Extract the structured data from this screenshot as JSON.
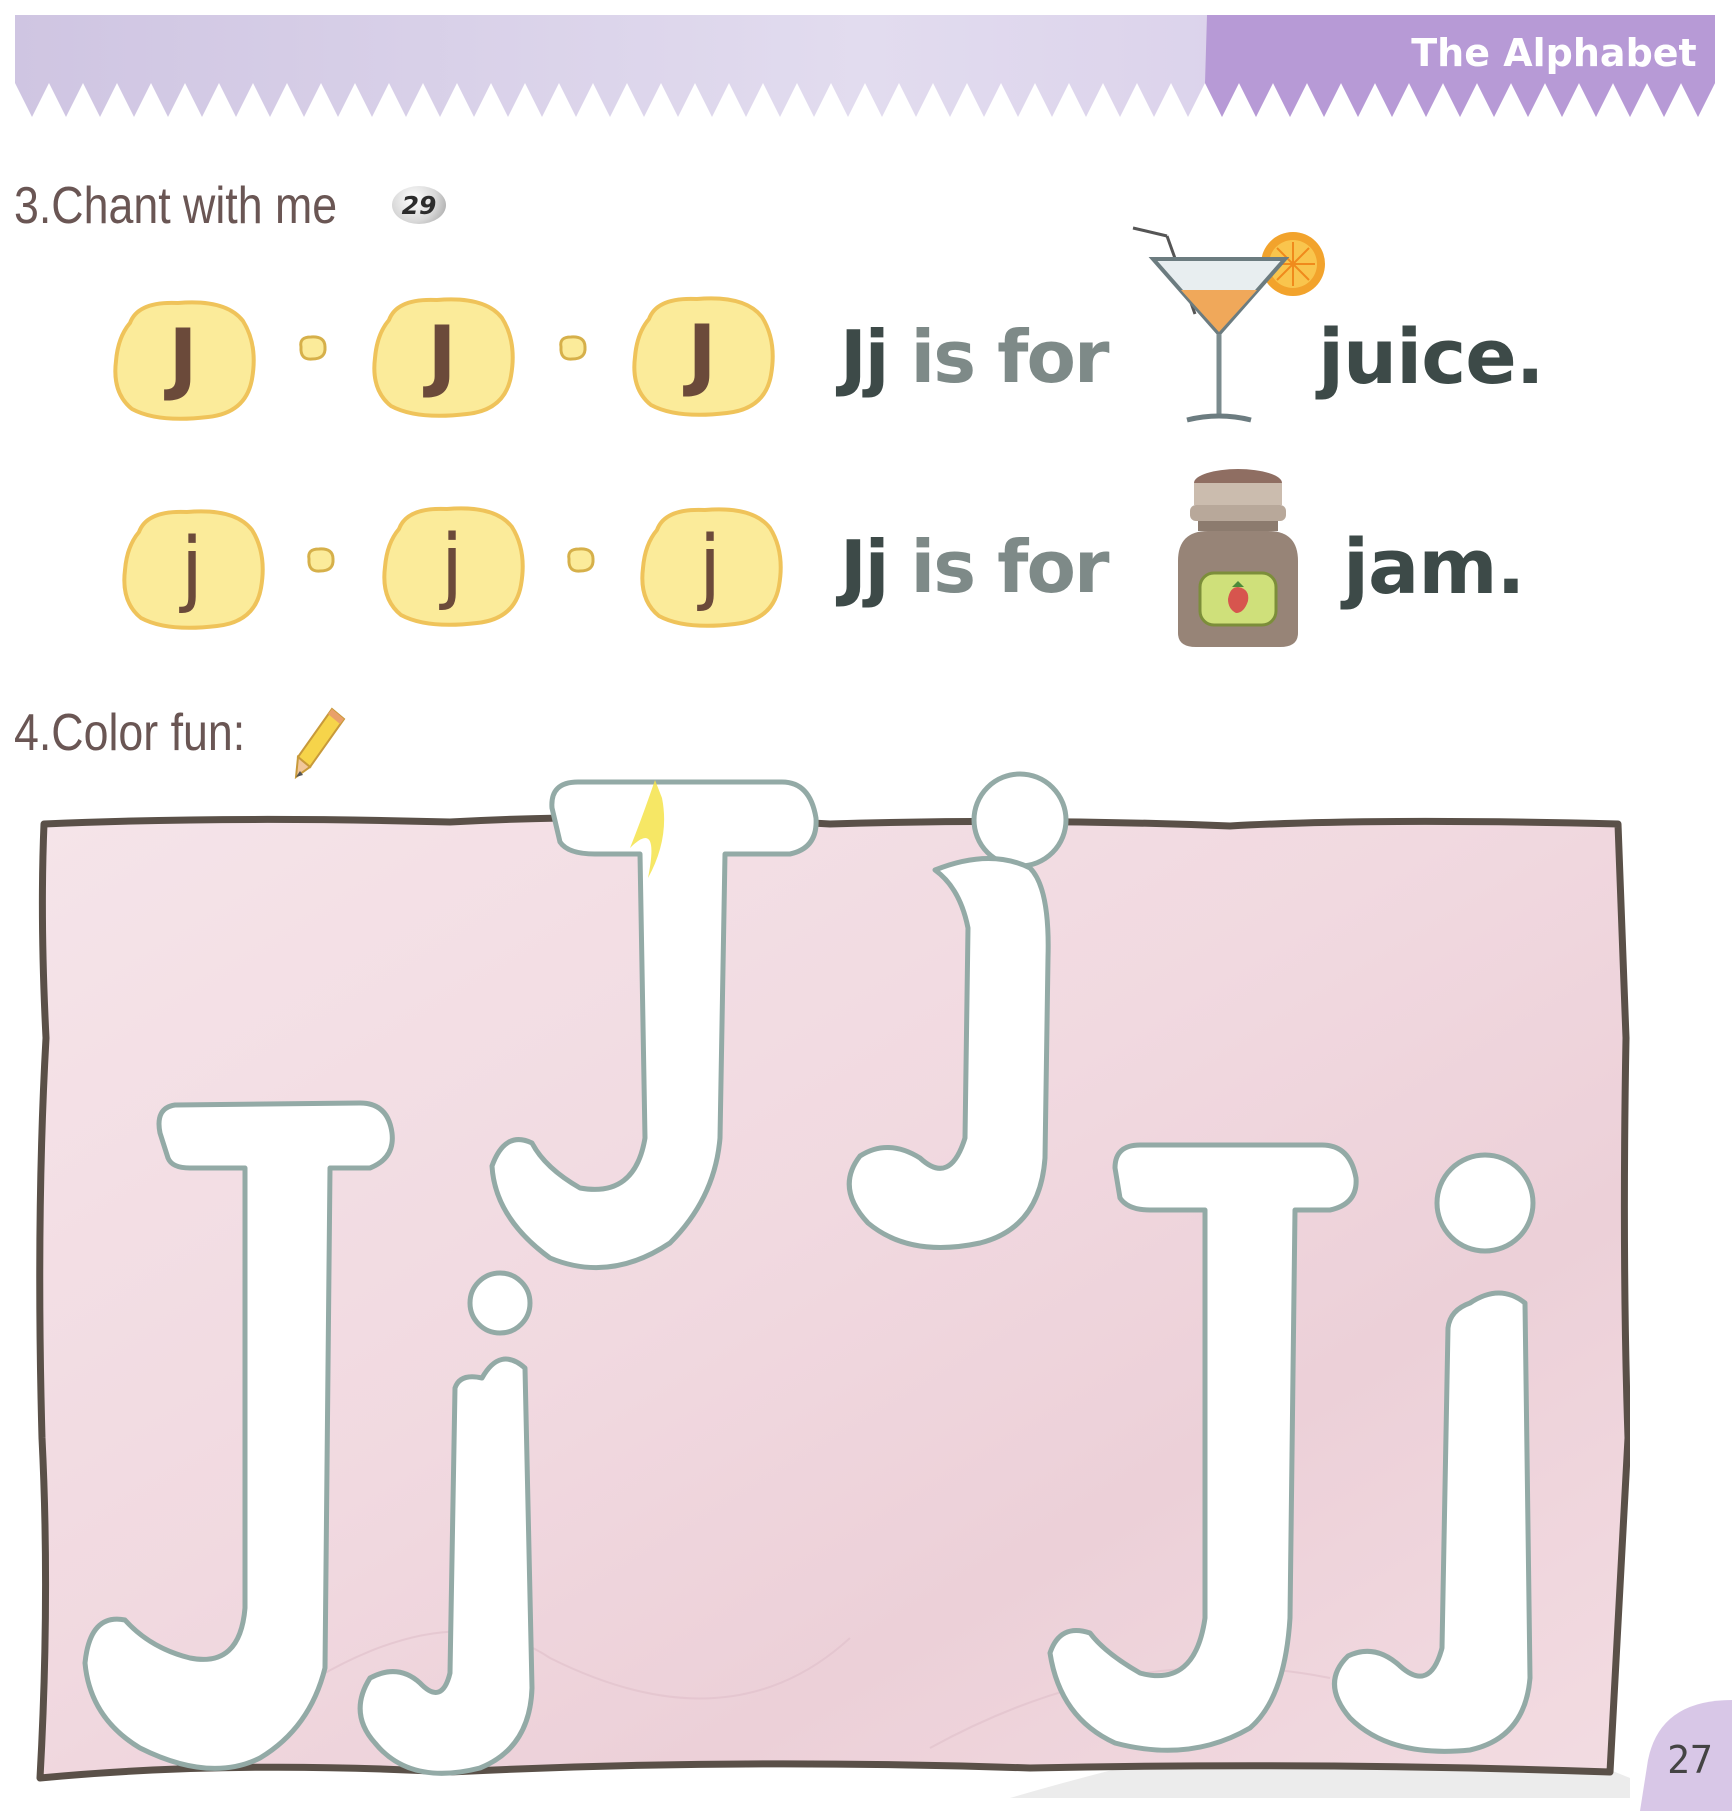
{
  "header": {
    "tag_label": "The Alphabet",
    "band_color": "#ddd5ec",
    "tag_color": "#b79ad6"
  },
  "sections": {
    "chant": {
      "title": "3.Chant with me",
      "track_number": "29"
    },
    "color": {
      "title": "4.Color fun:"
    }
  },
  "chant": {
    "upper_letters": [
      "J",
      "J",
      "J"
    ],
    "lower_letters": [
      "j",
      "j",
      "j"
    ],
    "lines": [
      {
        "letters": "Jj",
        "phrase": "is for",
        "word": "juice.",
        "icon": "cocktail-glass-icon"
      },
      {
        "letters": "Jj",
        "phrase": "is for",
        "word": "jam.",
        "icon": "jam-jar-icon"
      }
    ],
    "blob_color": "#fbeb9a",
    "blob_outline": "#efc35a"
  },
  "coloring": {
    "letters": [
      "J",
      "j",
      "J",
      "j",
      "J",
      "j"
    ],
    "background": "#f3dde4",
    "frame_color": "#5a5048",
    "outline_color": "#93aaa6"
  },
  "page_number": "27"
}
